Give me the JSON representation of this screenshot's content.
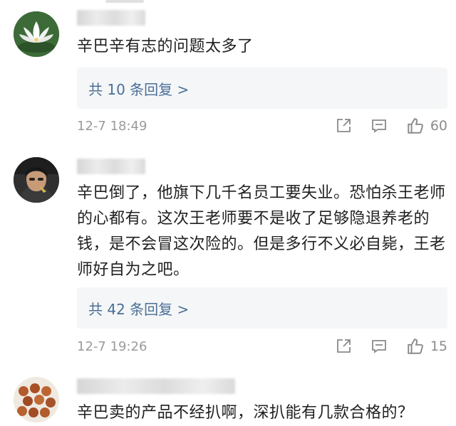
{
  "comments": [
    {
      "text": "辛巴辛有志的问题太多了",
      "replies_label": "共 10 条回复 >",
      "time": "12-7 18:49",
      "likes": "60"
    },
    {
      "text": "辛巴倒了，他旗下几千名员工要失业。恐怕杀王老师的心都有。这次王老师要不是收了足够隐退养老的钱，是不会冒这次险的。但是多行不义必自毙，王老师好自为之吧。",
      "replies_label": "共 42 条回复 >",
      "time": "12-7 19:26",
      "likes": "15"
    },
    {
      "text": "辛巴卖的产品不经扒啊，深扒能有几款合格的？"
    }
  ],
  "icons": {
    "share": "share-icon",
    "comment": "comment-icon",
    "like": "thumbs-up-icon"
  }
}
